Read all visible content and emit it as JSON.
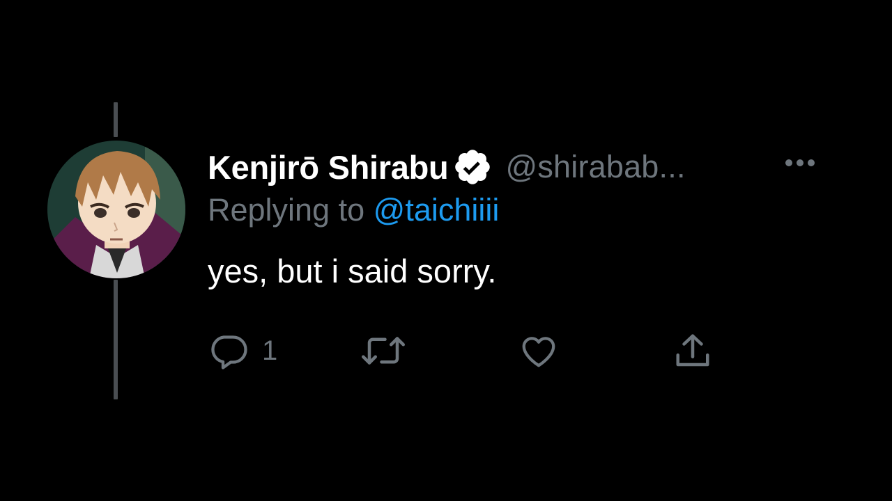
{
  "tweet": {
    "display_name": "Kenjirō Shirabu",
    "verified_icon": "verified-badge-icon",
    "handle": "@shirabab...",
    "more_icon": "more-horizontal-icon",
    "replying_prefix": "Replying to",
    "replying_to": "@taichiiii",
    "text": "yes, but i said sorry.",
    "avatar": "anime-character-avatar"
  },
  "actions": {
    "reply": {
      "icon": "reply-bubble-icon",
      "count": "1"
    },
    "retweet": {
      "icon": "retweet-icon"
    },
    "like": {
      "icon": "heart-icon"
    },
    "share": {
      "icon": "share-upload-icon"
    }
  },
  "colors": {
    "background": "#000000",
    "primary_text": "#ffffff",
    "secondary_text": "#6e767d",
    "link": "#1d9bf0",
    "thread_line": "#4a4e52"
  }
}
